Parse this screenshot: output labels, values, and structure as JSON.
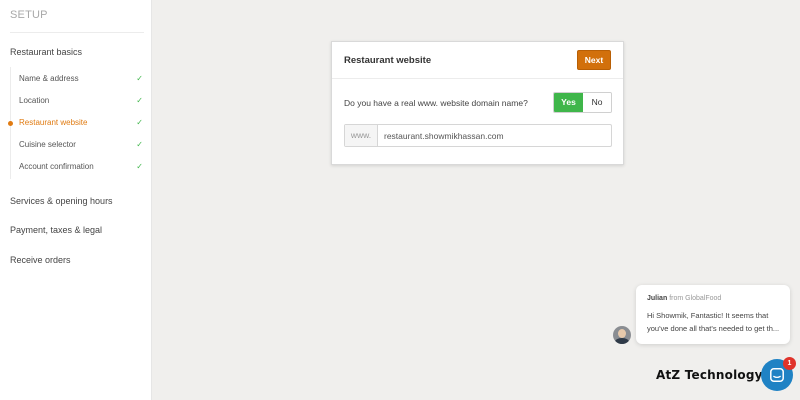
{
  "sidebar": {
    "title": "SETUP",
    "sections": [
      {
        "label": "Restaurant basics"
      },
      {
        "label": "Services & opening hours"
      },
      {
        "label": "Payment, taxes & legal"
      },
      {
        "label": "Receive orders"
      }
    ],
    "sub_items": [
      {
        "label": "Name & address",
        "done": true
      },
      {
        "label": "Location",
        "done": true
      },
      {
        "label": "Restaurant website",
        "done": true,
        "active": true
      },
      {
        "label": "Cuisine selector",
        "done": true
      },
      {
        "label": "Account confirmation",
        "done": true
      }
    ],
    "check_glyph": "✓"
  },
  "card": {
    "title": "Restaurant website",
    "next_label": "Next",
    "question": "Do you have a real www. website domain name?",
    "yes_label": "Yes",
    "no_label": "No",
    "selected": "Yes",
    "url_prefix": "www.",
    "url_value": "restaurant.showmikhassan.com"
  },
  "chat": {
    "sender": "Julian",
    "sender_org": "from GlobalFood",
    "message": "Hi Showmik, Fantastic! It seems that you've done all that's needed to get th...",
    "unread_count": "1",
    "launcher_icon": "chat-bubble-icon",
    "avatar_icon": "agent-avatar"
  },
  "watermark": "AtZ Technology",
  "colors": {
    "accent_orange": "#d2700b",
    "success_green": "#3fb64a",
    "chat_blue": "#1f82c4",
    "badge_red": "#e0332b"
  }
}
